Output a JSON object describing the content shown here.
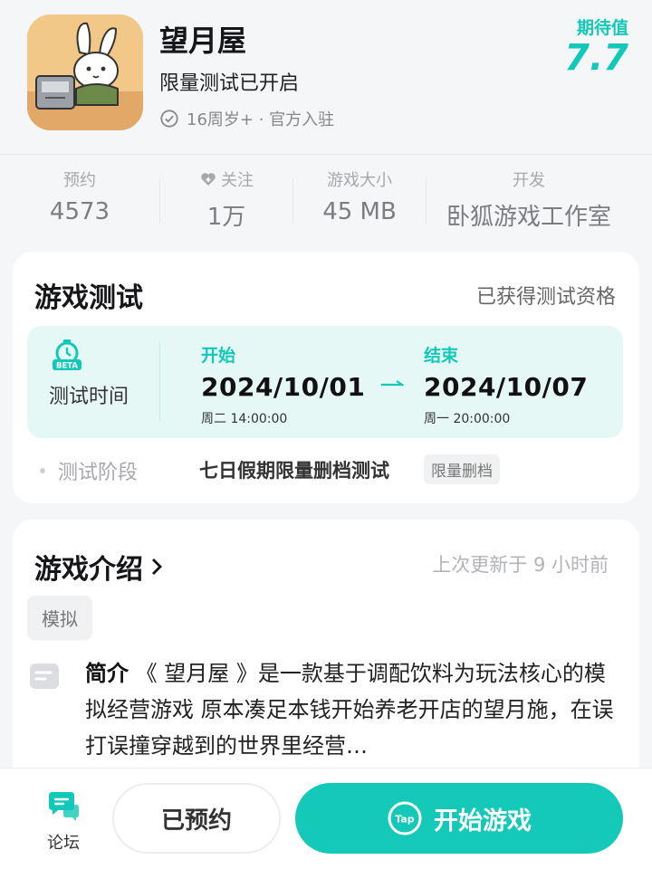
{
  "app": {
    "title": "望月屋",
    "subtitle": "限量测试已开启",
    "meta": "16周岁+ · 官方入驻",
    "expect_label": "期待值",
    "expect_value": "7.7"
  },
  "stats": [
    {
      "label": "预约",
      "value": "4573"
    },
    {
      "label": "关注",
      "value": "1万"
    },
    {
      "label": "游戏大小",
      "value": "45 MB"
    },
    {
      "label": "开发",
      "value": "卧狐游戏工作室"
    }
  ],
  "test": {
    "title": "游戏测试",
    "status": "已获得测试资格",
    "badge": "BETA",
    "time_label": "测试时间",
    "start_label": "开始",
    "start_date": "2024/10/01",
    "start_day": "周二  14:00:00",
    "end_label": "结束",
    "end_date": "2024/10/07",
    "end_day": "周一  20:00:00",
    "phase_label": "测试阶段",
    "phase_value": "七日假期限量删档测试",
    "phase_tag": "限量删档"
  },
  "intro": {
    "title": "游戏介绍",
    "updated": "上次更新于 9 小时前",
    "genre": "模拟",
    "desc_prefix": "简介",
    "desc_text": "《 望月屋 》是一款基于调配饮料为玩法核心的模拟经营游戏 原本凑足本钱开始养老开店的望月施，在误打误撞穿越到的世界里经营…"
  },
  "bottom": {
    "forum_label": "论坛",
    "reserved_label": "已预约",
    "play_label": "开始游戏",
    "tap_logo_text": "Tap"
  },
  "colors": {
    "accent": "#15c9b9",
    "test_box_bg": "#e6f8f6"
  }
}
